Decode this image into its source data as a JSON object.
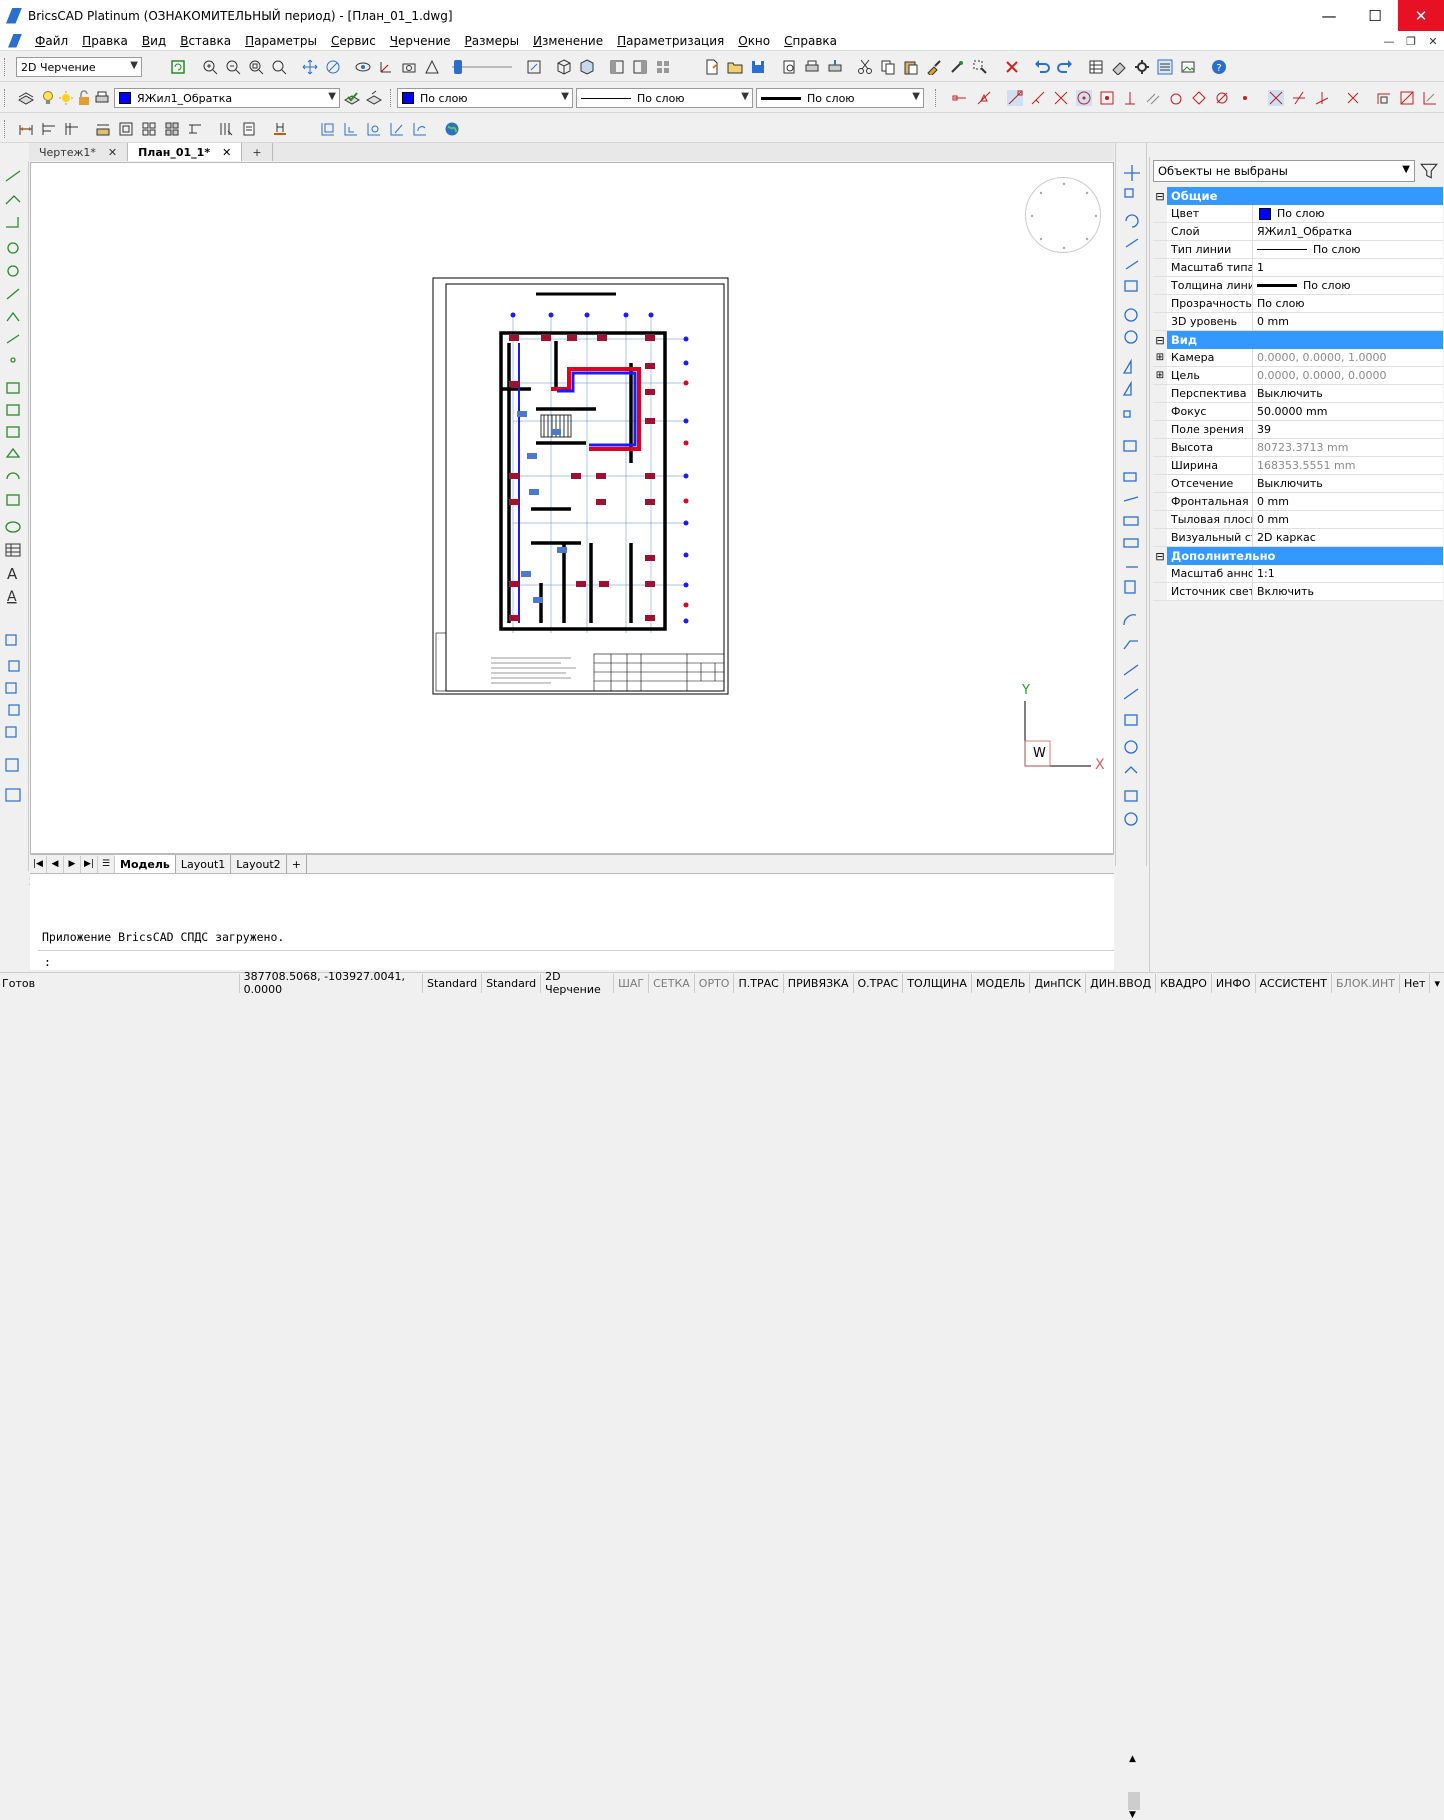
{
  "window": {
    "title": "BricsCAD Platinum (ОЗНАКОМИТЕЛЬНЫЙ период) - [План_01_1.dwg]",
    "controls": {
      "minimize": "—",
      "maximize": "☐",
      "close": "✕"
    }
  },
  "menu": [
    "Файл",
    "Правка",
    "Вид",
    "Вставка",
    "Параметры",
    "Сервис",
    "Черчение",
    "Размеры",
    "Изменение",
    "Параметризация",
    "Окно",
    "Справка"
  ],
  "toolbar": {
    "workspace": "2D Черчение",
    "layer": "ЯЖил1_Обратка",
    "color": "По слою",
    "linetype": "По слою",
    "lineweight": "По слою"
  },
  "tabs": [
    {
      "label": "Чертеж1*",
      "close": "✕"
    },
    {
      "label": "План_01_1*",
      "close": "✕"
    }
  ],
  "tab_add": "+",
  "layouts": [
    "Модель",
    "Layout1",
    "Layout2"
  ],
  "layout_add": "+",
  "command": {
    "message": "Приложение BricsCAD СПДС загружено.",
    "prompt": ":"
  },
  "ucs": {
    "y": "Y",
    "x": "X",
    "w": "W"
  },
  "status": {
    "ready": "Готов",
    "coords": "387708.5068, -103927.0041, 0.0000",
    "items": [
      {
        "label": "Standard",
        "off": false
      },
      {
        "label": "Standard",
        "off": false
      },
      {
        "label": "2D Черчение",
        "off": false
      },
      {
        "label": "ШАГ",
        "off": true
      },
      {
        "label": "СЕТКА",
        "off": true
      },
      {
        "label": "ОРТО",
        "off": true
      },
      {
        "label": "П.ТРАС",
        "off": false
      },
      {
        "label": "ПРИВЯЗКА",
        "off": false
      },
      {
        "label": "О.ТРАС",
        "off": false
      },
      {
        "label": "ТОЛЩИНА",
        "off": false
      },
      {
        "label": "МОДЕЛЬ",
        "off": false
      },
      {
        "label": "ДинПСК",
        "off": false
      },
      {
        "label": "ДИН.ВВОД",
        "off": false
      },
      {
        "label": "КВАДРО",
        "off": false
      },
      {
        "label": "ИНФО",
        "off": false
      },
      {
        "label": "АССИСТЕНТ",
        "off": false
      },
      {
        "label": "БЛОК.ИНТ",
        "off": true
      },
      {
        "label": "Нет",
        "off": false
      }
    ]
  },
  "properties": {
    "selection": "Объекты не выбраны",
    "sections": [
      {
        "title": "Общие",
        "rows": [
          {
            "key": "Цвет",
            "value": "По слою",
            "ro": false
          },
          {
            "key": "Слой",
            "value": "ЯЖил1_Обратка",
            "ro": false
          },
          {
            "key": "Тип линии",
            "value": "По слою",
            "ro": false
          },
          {
            "key": "Масштаб типа л",
            "value": "1",
            "ro": false
          },
          {
            "key": "Толщина линии",
            "value": "По слою",
            "ro": false
          },
          {
            "key": "Прозрачность",
            "value": "По слою",
            "ro": false
          },
          {
            "key": "3D уровень",
            "value": "0 mm",
            "ro": false
          }
        ]
      },
      {
        "title": "Вид",
        "rows": [
          {
            "key": "Камера",
            "value": "0.0000, 0.0000, 1.0000",
            "ro": true,
            "expand": "+"
          },
          {
            "key": "Цель",
            "value": "0.0000, 0.0000, 0.0000",
            "ro": true,
            "expand": "+"
          },
          {
            "key": "Перспектива",
            "value": "Выключить",
            "ro": false
          },
          {
            "key": "Фокус",
            "value": "50.0000 mm",
            "ro": false
          },
          {
            "key": "Поле зрения",
            "value": "39",
            "ro": false
          },
          {
            "key": "Высота",
            "value": "80723.3713 mm",
            "ro": true
          },
          {
            "key": "Ширина",
            "value": "168353.5551 mm",
            "ro": true
          },
          {
            "key": "Отсечение",
            "value": "Выключить",
            "ro": false
          },
          {
            "key": "Фронтальная пл",
            "value": "0 mm",
            "ro": false
          },
          {
            "key": "Тыловая плоско",
            "value": "0 mm",
            "ro": false
          },
          {
            "key": "Визуальный сти",
            "value": "2D каркас",
            "ro": false
          }
        ]
      },
      {
        "title": "Дополнительно",
        "rows": [
          {
            "key": "Масштаб аннота",
            "value": "1:1",
            "ro": false
          },
          {
            "key": "Источник света",
            "value": "Включить",
            "ro": false
          }
        ]
      }
    ]
  }
}
